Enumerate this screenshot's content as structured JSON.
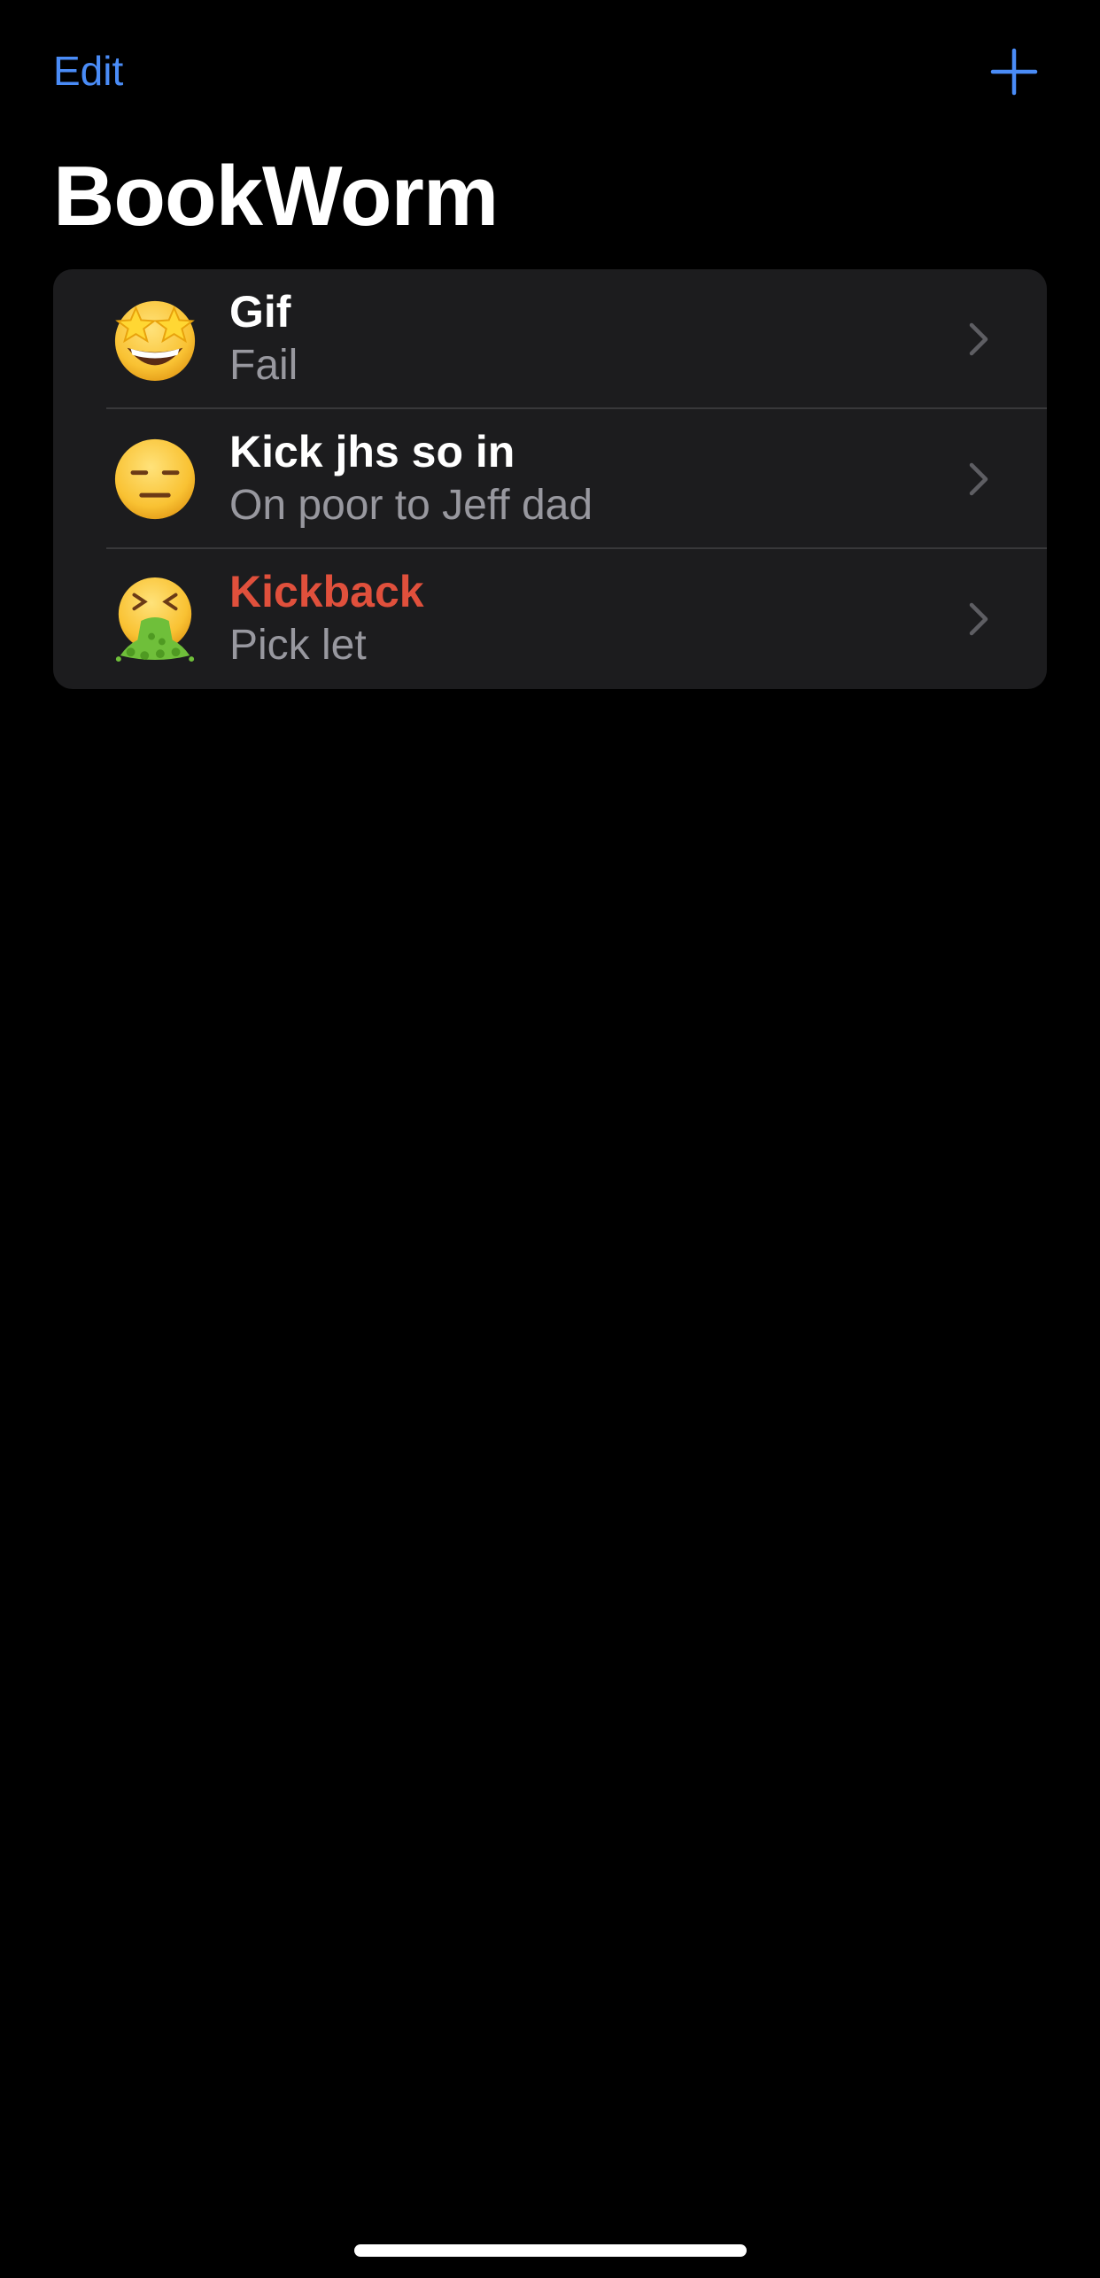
{
  "nav": {
    "edit_label": "Edit",
    "add_icon": "plus-icon",
    "accent_color": "#4a8cf7"
  },
  "title": "BookWorm",
  "books": [
    {
      "title": "Gif",
      "subtitle": "Fail",
      "rating_icon": "star-struck-emoji-icon",
      "title_color": "#ffffff"
    },
    {
      "title": "Kick jhs so in",
      "subtitle": "On poor to Jeff dad",
      "rating_icon": "expressionless-face-emoji-icon",
      "title_color": "#ffffff"
    },
    {
      "title": "Kickback",
      "subtitle": "Pick let",
      "rating_icon": "vomiting-face-emoji-icon",
      "title_color": "#e0503c"
    }
  ],
  "chevron_icon": "chevron-right-icon"
}
